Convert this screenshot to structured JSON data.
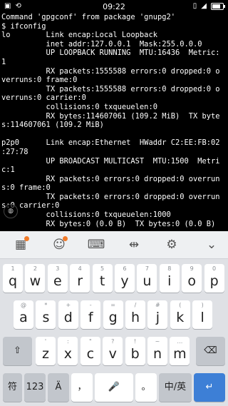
{
  "status_bar": {
    "time": "09:22",
    "icons_left": [
      "terminal-notification-icon",
      "sync-notification-icon"
    ],
    "icons_right": [
      "vibrate-icon",
      "signal-icon",
      "battery-icon"
    ],
    "battery_level": 0.8
  },
  "terminal": {
    "lines": [
      "Command 'gpgconf' from package 'gnupg2'",
      "$ ifconfig",
      "lo        Link encap:Local Loopback",
      "          inet addr:127.0.0.1  Mask:255.0.0.0",
      "          UP LOOPBACK RUNNING  MTU:16436  Metric:",
      "1",
      "          RX packets:1555588 errors:0 dropped:0 o",
      "verruns:0 frame:0",
      "          TX packets:1555588 errors:0 dropped:0 o",
      "verruns:0 carrier:0",
      "          collisions:0 txqueuelen:0",
      "          RX bytes:114607061 (109.2 MiB)  TX byte",
      "s:114607061 (109.2 MiB)",
      "",
      "p2p0      Link encap:Ethernet  HWaddr C2:EE:FB:02",
      ":27:78",
      "          UP BROADCAST MULTICAST  MTU:1500  Metri",
      "c:1",
      "          RX packets:0 errors:0 dropped:0 overrun",
      "s:0 frame:0",
      "          TX packets:0 errors:0 dropped:0 overrun",
      "s:0 carrier:0",
      "          collisions:0 txqueuelen:1000",
      "          RX bytes:0 (0.0 B)  TX bytes:0 (0.0 B)"
    ]
  },
  "keyboard": {
    "toolbar": [
      "apps-icon",
      "emoji-icon",
      "keyboard-icon",
      "cursor-icon",
      "settings-icon",
      "collapse-icon"
    ],
    "rows": [
      [
        {
          "k": "q",
          "h": "1"
        },
        {
          "k": "w",
          "h": "2"
        },
        {
          "k": "e",
          "h": "3"
        },
        {
          "k": "r",
          "h": "4"
        },
        {
          "k": "t",
          "h": "5"
        },
        {
          "k": "y",
          "h": "6"
        },
        {
          "k": "u",
          "h": "7"
        },
        {
          "k": "i",
          "h": "8"
        },
        {
          "k": "o",
          "h": "9"
        },
        {
          "k": "p",
          "h": "0"
        }
      ],
      [
        {
          "k": "a",
          "h": "@"
        },
        {
          "k": "s",
          "h": "*"
        },
        {
          "k": "d",
          "h": "+"
        },
        {
          "k": "f",
          "h": "-"
        },
        {
          "k": "g",
          "h": "="
        },
        {
          "k": "h",
          "h": "/"
        },
        {
          "k": "j",
          "h": "#"
        },
        {
          "k": "k",
          "h": "("
        },
        {
          "k": "l",
          "h": ")"
        }
      ],
      [
        {
          "k": "z",
          "h": "'"
        },
        {
          "k": "x",
          "h": ":"
        },
        {
          "k": "c",
          "h": "\""
        },
        {
          "k": "v",
          "h": "?"
        },
        {
          "k": "b",
          "h": "!"
        },
        {
          "k": "n",
          "h": "~"
        },
        {
          "k": "m",
          "h": "…"
        }
      ]
    ],
    "bottom": {
      "symbols": "符",
      "numbers": "123",
      "comma": "，",
      "period": "。",
      "lang": "中/英"
    }
  }
}
